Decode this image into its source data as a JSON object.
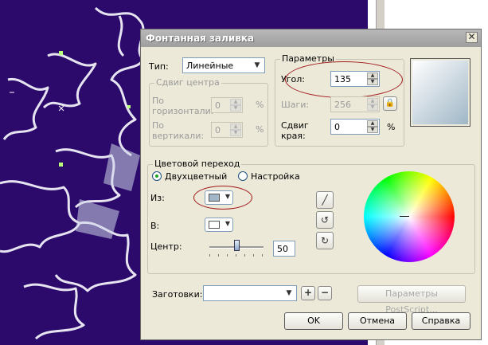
{
  "dialog": {
    "title": "Фонтанная заливка",
    "type_label": "Тип:",
    "type_value": "Линейные",
    "center_offset": {
      "title": "Сдвиг центра",
      "horizontal_label_1": "По",
      "horizontal_label_2": "горизонтали:",
      "horizontal_value": "0",
      "vertical_label_1": "По",
      "vertical_label_2": "вертикали:",
      "vertical_value": "0",
      "unit": "%"
    },
    "params": {
      "title": "Параметры",
      "angle_label": "Угол:",
      "angle_value": "135",
      "steps_label": "Шаги:",
      "steps_value": "256",
      "edge_label_1": "Сдвиг",
      "edge_label_2": "края:",
      "edge_value": "0",
      "unit": "%"
    },
    "transition": {
      "title": "Цветовой переход",
      "radio_two_color": "Двухцветный",
      "radio_custom": "Настройка",
      "from_label": "Из:",
      "from_color": "#a3b6c8",
      "to_label": "В:",
      "to_color": "#ffffff",
      "center_label": "Центр:",
      "center_value": "50",
      "center_slider": 0.5
    },
    "presets_label": "Заготовки:",
    "postscript_button": "Параметры PostScript...",
    "ok": "OK",
    "cancel": "Отмена",
    "help": "Справка"
  },
  "colors": {
    "canvas_bg": "#2b0a6b",
    "preview_start": "#ffffff",
    "preview_end": "#9fb6c6",
    "highlight": "#a01818"
  }
}
